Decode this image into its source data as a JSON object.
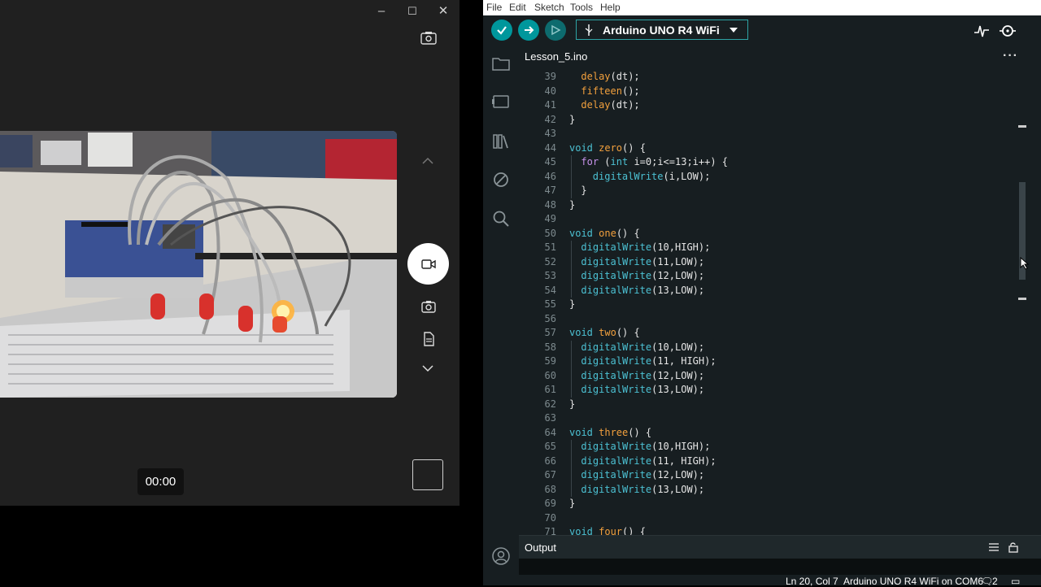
{
  "camera": {
    "window_controls": [
      "–",
      "☐",
      "✕"
    ],
    "timer": "00:00",
    "icons": [
      "switch-camera-icon",
      "chevron-up-icon",
      "video-mode-icon",
      "photo-mode-icon",
      "document-mode-icon",
      "chevron-down-icon"
    ]
  },
  "ide": {
    "menu": [
      "File",
      "Edit",
      "Sketch",
      "Tools",
      "Help"
    ],
    "board": "Arduino UNO R4 WiFi",
    "tab": "Lesson_5.ino",
    "output_label": "Output",
    "status": {
      "position": "Ln 20, Col 7",
      "board_port": "Arduino UNO R4 WiFi on COM6",
      "notifications": "2"
    },
    "colors": {
      "accent": "#00979c",
      "verify": "#00979c",
      "background": "#171e21",
      "keyword": "#c792ea",
      "function": "#f2a03d",
      "builtin": "#4cc1d3"
    },
    "code_lines": [
      {
        "n": "39",
        "i": 1,
        "tokens": [
          [
            "delay",
            "f"
          ],
          [
            "(dt);",
            "t"
          ]
        ]
      },
      {
        "n": "40",
        "i": 1,
        "tokens": [
          [
            "fifteen",
            "f"
          ],
          [
            "();",
            "t"
          ]
        ]
      },
      {
        "n": "41",
        "i": 1,
        "tokens": [
          [
            "delay",
            "f"
          ],
          [
            "(dt);",
            "t"
          ]
        ]
      },
      {
        "n": "42",
        "i": 0,
        "tokens": [
          [
            "}",
            "t"
          ]
        ]
      },
      {
        "n": "43",
        "i": 0,
        "tokens": []
      },
      {
        "n": "44",
        "i": 0,
        "tokens": [
          [
            "void ",
            "b"
          ],
          [
            "zero",
            "f"
          ],
          [
            "() {",
            "t"
          ]
        ]
      },
      {
        "n": "45",
        "i": 1,
        "tokens": [
          [
            "for ",
            "k"
          ],
          [
            "(",
            "t"
          ],
          [
            "int ",
            "b"
          ],
          [
            "i=0;i<=13;i++) {",
            "t"
          ]
        ]
      },
      {
        "n": "46",
        "i": 2,
        "tokens": [
          [
            "digitalWrite",
            "b"
          ],
          [
            "(i,LOW);",
            "t"
          ]
        ]
      },
      {
        "n": "47",
        "i": 1,
        "tokens": [
          [
            "}",
            "t"
          ]
        ]
      },
      {
        "n": "48",
        "i": 0,
        "tokens": [
          [
            "}",
            "t"
          ]
        ]
      },
      {
        "n": "49",
        "i": 0,
        "tokens": []
      },
      {
        "n": "50",
        "i": 0,
        "tokens": [
          [
            "void ",
            "b"
          ],
          [
            "one",
            "f"
          ],
          [
            "() {",
            "t"
          ]
        ]
      },
      {
        "n": "51",
        "i": 1,
        "tokens": [
          [
            "digitalWrite",
            "b"
          ],
          [
            "(10,HIGH);",
            "t"
          ]
        ]
      },
      {
        "n": "52",
        "i": 1,
        "tokens": [
          [
            "digitalWrite",
            "b"
          ],
          [
            "(11,LOW);",
            "t"
          ]
        ]
      },
      {
        "n": "53",
        "i": 1,
        "tokens": [
          [
            "digitalWrite",
            "b"
          ],
          [
            "(12,LOW);",
            "t"
          ]
        ]
      },
      {
        "n": "54",
        "i": 1,
        "tokens": [
          [
            "digitalWrite",
            "b"
          ],
          [
            "(13,LOW);",
            "t"
          ]
        ]
      },
      {
        "n": "55",
        "i": 0,
        "tokens": [
          [
            "}",
            "t"
          ]
        ]
      },
      {
        "n": "56",
        "i": 0,
        "tokens": []
      },
      {
        "n": "57",
        "i": 0,
        "tokens": [
          [
            "void ",
            "b"
          ],
          [
            "two",
            "f"
          ],
          [
            "() {",
            "t"
          ]
        ]
      },
      {
        "n": "58",
        "i": 1,
        "tokens": [
          [
            "digitalWrite",
            "b"
          ],
          [
            "(10,LOW);",
            "t"
          ]
        ]
      },
      {
        "n": "59",
        "i": 1,
        "tokens": [
          [
            "digitalWrite",
            "b"
          ],
          [
            "(11, HIGH);",
            "t"
          ]
        ]
      },
      {
        "n": "60",
        "i": 1,
        "tokens": [
          [
            "digitalWrite",
            "b"
          ],
          [
            "(12,LOW);",
            "t"
          ]
        ]
      },
      {
        "n": "61",
        "i": 1,
        "tokens": [
          [
            "digitalWrite",
            "b"
          ],
          [
            "(13,LOW);",
            "t"
          ]
        ]
      },
      {
        "n": "62",
        "i": 0,
        "tokens": [
          [
            "}",
            "t"
          ]
        ]
      },
      {
        "n": "63",
        "i": 0,
        "tokens": []
      },
      {
        "n": "64",
        "i": 0,
        "tokens": [
          [
            "void ",
            "b"
          ],
          [
            "three",
            "f"
          ],
          [
            "() {",
            "t"
          ]
        ]
      },
      {
        "n": "65",
        "i": 1,
        "tokens": [
          [
            "digitalWrite",
            "b"
          ],
          [
            "(10,HIGH);",
            "t"
          ]
        ]
      },
      {
        "n": "66",
        "i": 1,
        "tokens": [
          [
            "digitalWrite",
            "b"
          ],
          [
            "(11, HIGH);",
            "t"
          ]
        ]
      },
      {
        "n": "67",
        "i": 1,
        "tokens": [
          [
            "digitalWrite",
            "b"
          ],
          [
            "(12,LOW);",
            "t"
          ]
        ]
      },
      {
        "n": "68",
        "i": 1,
        "tokens": [
          [
            "digitalWrite",
            "b"
          ],
          [
            "(13,LOW);",
            "t"
          ]
        ]
      },
      {
        "n": "69",
        "i": 0,
        "tokens": [
          [
            "}",
            "t"
          ]
        ]
      },
      {
        "n": "70",
        "i": 0,
        "tokens": []
      },
      {
        "n": "71",
        "i": 0,
        "tokens": [
          [
            "void ",
            "b"
          ],
          [
            "four",
            "f"
          ],
          [
            "() {",
            "t"
          ]
        ]
      }
    ]
  }
}
